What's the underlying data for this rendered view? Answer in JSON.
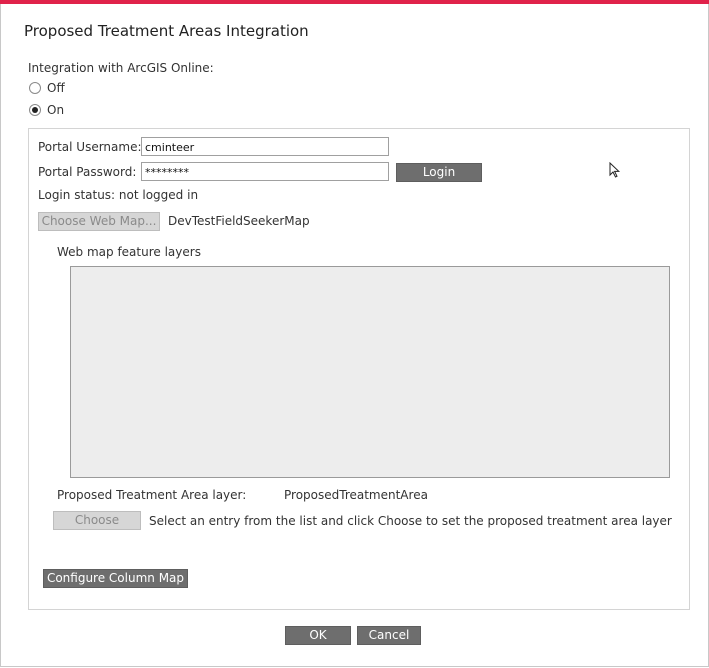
{
  "dialog": {
    "title": "Proposed Treatment Areas Integration",
    "accent_color": "#e0224a"
  },
  "integration": {
    "label": "Integration with ArcGIS Online:",
    "options": [
      {
        "label": "Off",
        "selected": false
      },
      {
        "label": "On",
        "selected": true
      }
    ]
  },
  "login": {
    "username_label": "Portal Username:",
    "username_value": "cminteer",
    "password_label": "Portal Password:",
    "password_value": "********",
    "login_button": "Login",
    "status": "Login status: not logged in"
  },
  "webmap": {
    "choose_button": "Choose Web Map...",
    "selected_map": "DevTestFieldSeekerMap",
    "layers_label": "Web map feature layers"
  },
  "treatment": {
    "layer_label": "Proposed Treatment Area layer:",
    "layer_value": "ProposedTreatmentArea",
    "choose_button": "Choose",
    "hint": "Select an entry from the list and click Choose to set the proposed treatment area layer"
  },
  "configure_button": "Configure Column Map",
  "footer": {
    "ok": "OK",
    "cancel": "Cancel"
  },
  "icons": {
    "cursor": "mouse-pointer-icon"
  }
}
